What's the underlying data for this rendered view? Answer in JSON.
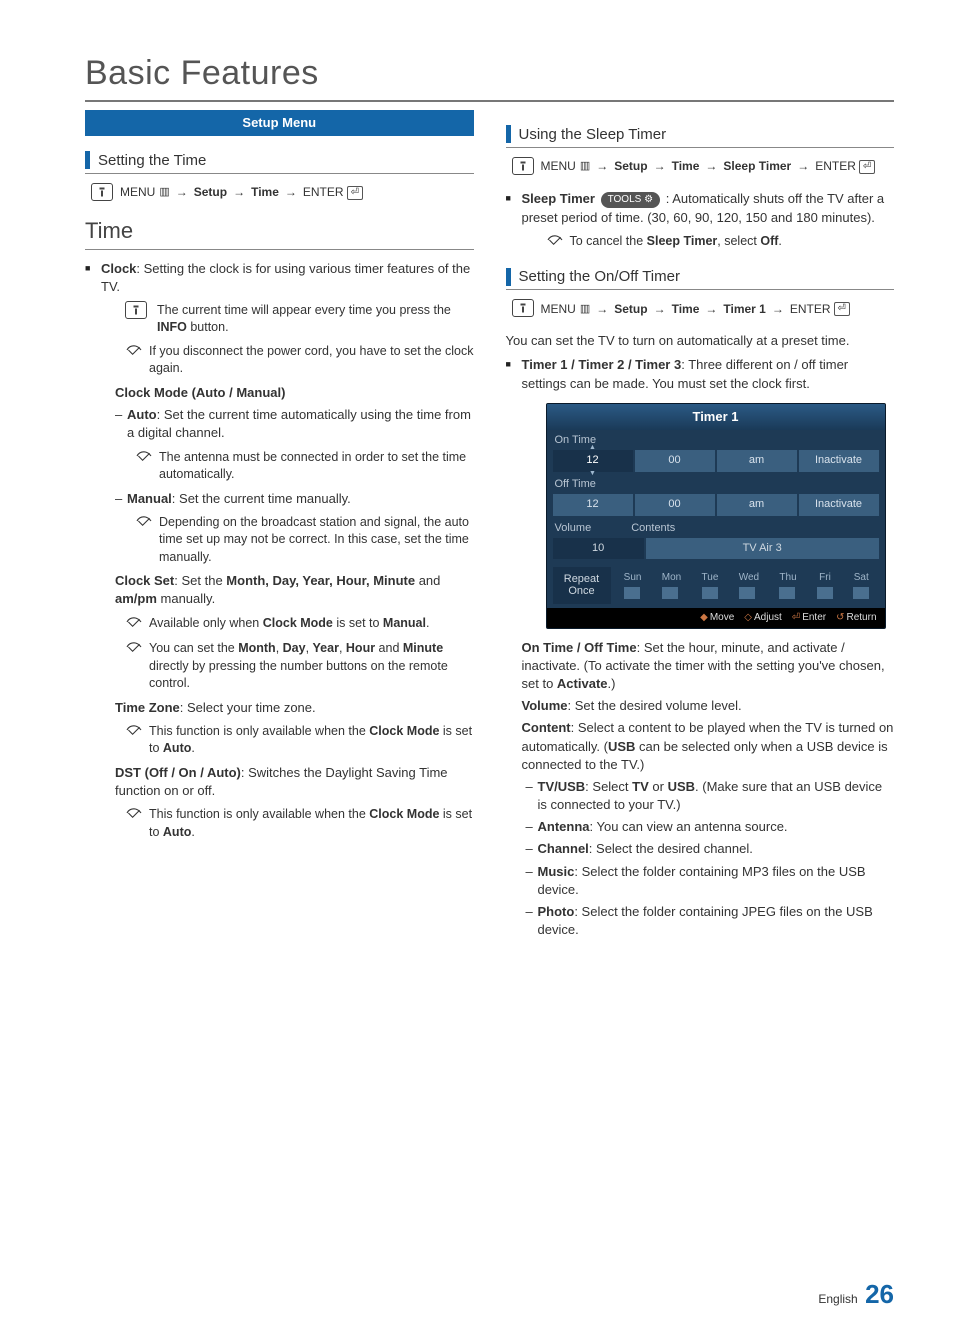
{
  "page_title": "Basic Features",
  "setup_banner": "Setup Menu",
  "left": {
    "setting_time": "Setting the Time",
    "path1": {
      "menu": "MENU",
      "steps": [
        "Setup",
        "Time"
      ],
      "enter": "ENTER"
    },
    "time_heading": "Time",
    "clock_intro_b": "Clock",
    "clock_intro": ": Setting the clock is for using various timer features of the TV.",
    "note_info": "The current time will appear every time you press the ",
    "note_info_b": "INFO",
    "note_info_end": " button.",
    "note_disconnect": "If you disconnect the power cord, you have to set the clock again.",
    "clock_mode_h": "Clock Mode (Auto / Manual)",
    "auto_b": "Auto",
    "auto_txt": ": Set the current time automatically using the time from a digital channel.",
    "auto_note": "The antenna must be connected in order to set the time automatically.",
    "manual_b": "Manual",
    "manual_txt": ": Set the current time manually.",
    "manual_note": "Depending on the broadcast station and signal, the auto time set up may not be correct. In this case, set the time manually.",
    "clock_set_b": "Clock Set",
    "clock_set_txt": ": Set the ",
    "clock_set_fields": "Month, Day, Year, Hour, Minute",
    "clock_set_end": " and ",
    "clock_set_ampm": "am/pm",
    "clock_set_tail": " manually.",
    "cs_note1a": "Available only when ",
    "cs_note1b": "Clock Mode",
    "cs_note1c": " is set to ",
    "cs_note1d": "Manual",
    "cs_note2a": "You can set the ",
    "cs_note2b": "Month",
    "cs_note2c": "Day",
    "cs_note2d": "Year",
    "cs_note2e": "Hour",
    "cs_note2f": "Minute",
    "cs_note2g": " directly by pressing the number buttons on the remote control.",
    "tz_b": "Time Zone",
    "tz_txt": ": Select your time zone.",
    "tz_note_a": "This function is only available when the ",
    "tz_note_b": "Clock Mode",
    "tz_note_c": " is set to ",
    "tz_note_d": "Auto",
    "dst_b": "DST (Off / On / Auto)",
    "dst_txt": ": Switches the Daylight Saving Time function on or off.",
    "dst_note_a": "This function is only available when the ",
    "dst_note_b": "Clock Mode",
    "dst_note_c": " is set to ",
    "dst_note_d": "Auto"
  },
  "right": {
    "sleep_h": "Using the Sleep Timer",
    "path2": {
      "menu": "MENU",
      "steps": [
        "Setup",
        "Time",
        "Sleep Timer"
      ],
      "enter": "ENTER"
    },
    "sleep_b": "Sleep Timer",
    "tools": "TOOLS",
    "sleep_txt": ": Automatically shuts off the TV after a preset period of time. (30, 60, 90, 120, 150 and 180 minutes).",
    "sleep_note_a": "To cancel the ",
    "sleep_note_b": "Sleep Timer",
    "sleep_note_c": ", select ",
    "sleep_note_d": "Off",
    "onoff_h": "Setting the On/Off Timer",
    "path3": {
      "menu": "MENU",
      "steps": [
        "Setup",
        "Time",
        "Timer 1"
      ],
      "enter": "ENTER"
    },
    "onoff_intro": "You can set the TV to turn on automatically at a preset time.",
    "t123_b": "Timer 1 / Timer 2 / Timer 3",
    "t123_txt": ": Three different on / off timer settings can be made. You must set the clock first.",
    "ontime_b": "On Time / Off Time",
    "ontime_txt": ": Set the hour, minute, and activate / inactivate. (To activate the timer with the setting you've chosen, set to ",
    "ontime_act": "Activate",
    "volume_b": "Volume",
    "volume_txt": ": Set the desired volume level.",
    "content_b": "Content",
    "content_txt1": ": Select a content to be played when the TV is turned on automatically. (",
    "content_usb": "USB",
    "content_txt2": " can be selected only when a USB device is connected to the TV.)",
    "tvusb_b": "TV/USB",
    "tvusb_txt": ": Select ",
    "tvusb_tv": "TV",
    "tvusb_or": " or ",
    "tvusb_usb": "USB",
    "tvusb_tail": ". (Make sure that an USB device is connected to your TV.)",
    "ant_b": "Antenna",
    "ant_txt": ": You can view an antenna source.",
    "ch_b": "Channel",
    "ch_txt": ": Select the desired channel.",
    "music_b": "Music",
    "music_txt": ": Select the folder containing MP3 files on the USB device.",
    "photo_b": "Photo",
    "photo_txt": ": Select the folder containing JPEG files on the USB device."
  },
  "timer_ui": {
    "title": "Timer 1",
    "on_time": "On Time",
    "off_time": "Off Time",
    "row": {
      "h": "12",
      "m": "00",
      "ap": "am",
      "act": "Inactivate"
    },
    "volume_l": "Volume",
    "contents_l": "Contents",
    "vol_val": "10",
    "content_val": "TV   Air   3",
    "repeat": "Repeat",
    "once": "Once",
    "days": [
      "Sun",
      "Mon",
      "Tue",
      "Wed",
      "Thu",
      "Fri",
      "Sat"
    ],
    "foot": {
      "move": "Move",
      "adjust": "Adjust",
      "enter": "Enter",
      "return": "Return"
    }
  },
  "footer": {
    "lang": "English",
    "num": "26"
  }
}
